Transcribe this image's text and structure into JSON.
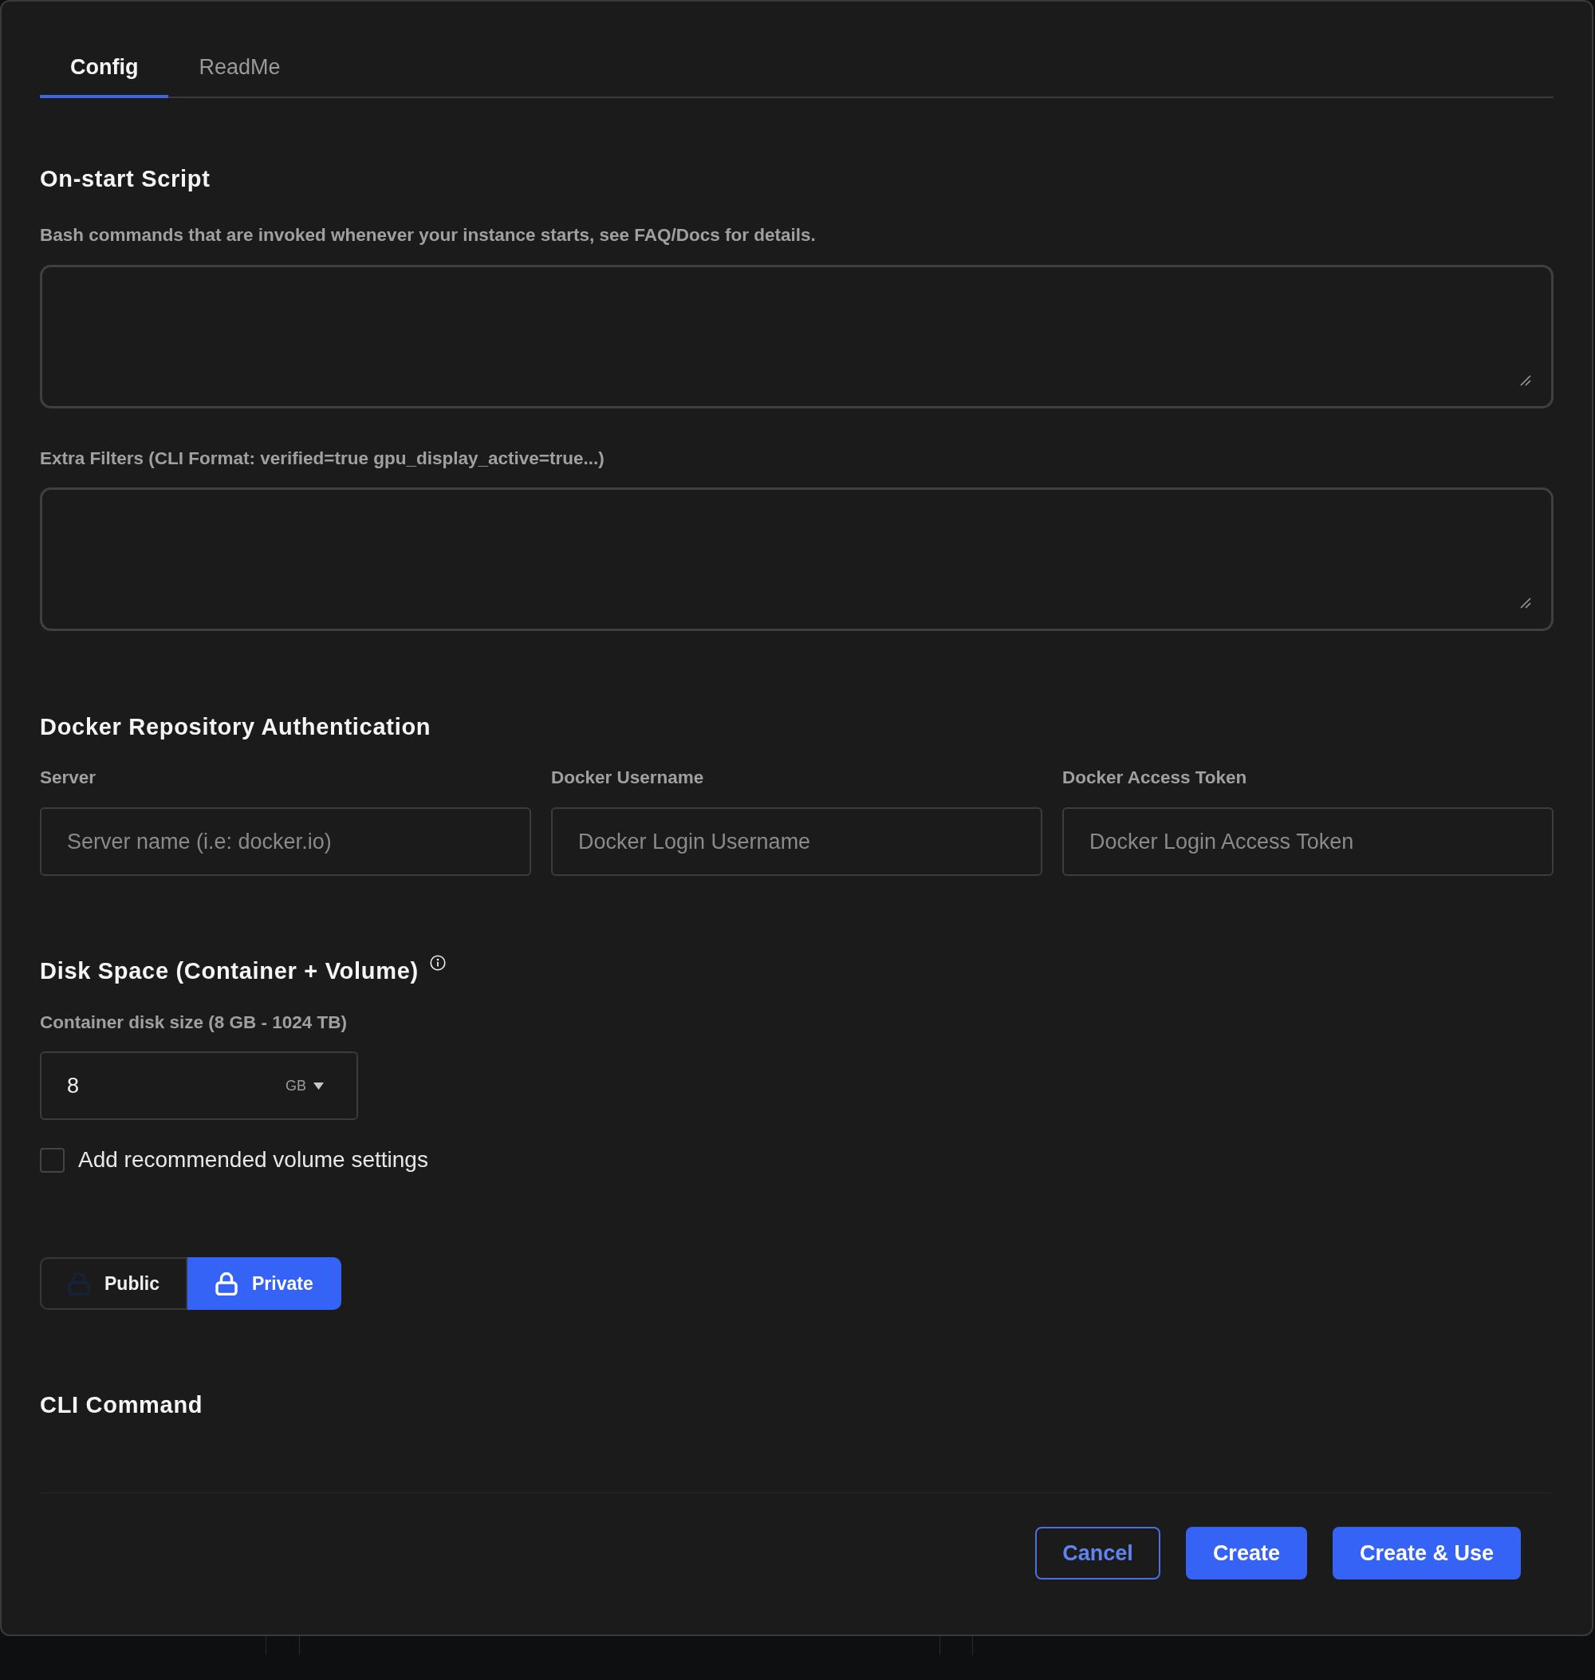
{
  "tabs": [
    {
      "label": "Config",
      "selected": true
    },
    {
      "label": "ReadMe",
      "selected": false
    }
  ],
  "on_start_script": {
    "title": "On-start Script",
    "description": "Bash commands that are invoked whenever your instance starts, see FAQ/Docs for details."
  },
  "extra_filters": {
    "label": "Extra Filters (CLI Format: verified=true gpu_display_active=true...)"
  },
  "docker_auth": {
    "title": "Docker Repository Authentication",
    "fields": [
      {
        "label": "Server",
        "placeholder": "Server name (i.e: docker.io)"
      },
      {
        "label": "Docker Username",
        "placeholder": "Docker Login Username"
      },
      {
        "label": "Docker Access Token",
        "placeholder": "Docker Login Access Token"
      }
    ]
  },
  "disk_space": {
    "title": "Disk Space (Container + Volume)",
    "container_disk": {
      "label": "Container disk size (8 GB - 1024 TB)",
      "value": "8",
      "unit": "GB"
    },
    "volume_option": {
      "label": "Add recommended volume settings",
      "checked": false
    }
  },
  "visibility": [
    {
      "label": "Public",
      "selected": false
    },
    {
      "label": "Private",
      "selected": true
    }
  ],
  "cli_command": {
    "title": "CLI Command"
  },
  "buttons": [
    {
      "label": "Cancel",
      "kind": "outline"
    },
    {
      "label": "Create",
      "kind": "primary"
    },
    {
      "label": "Create & Use",
      "kind": "primary"
    }
  ]
}
